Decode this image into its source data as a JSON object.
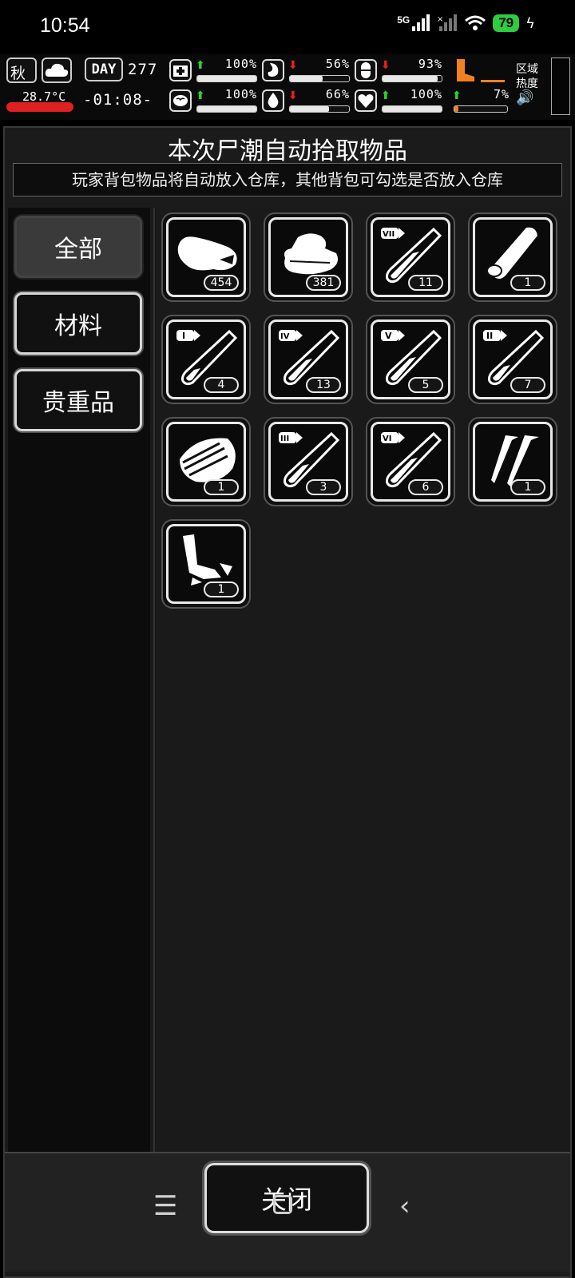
{
  "status_bar": {
    "time": "10:54",
    "network": "5G",
    "battery": "79"
  },
  "hud": {
    "season": "秋",
    "temperature": "28.7°C",
    "day_label": "DAY",
    "day_number": "277",
    "clock": "-01:08-",
    "stats": [
      {
        "icon": "medkit-icon",
        "trend": "up",
        "value": "100%",
        "level": 1.0
      },
      {
        "icon": "stomach-icon",
        "trend": "down",
        "value": "56%",
        "level": 0.56
      },
      {
        "icon": "pill-icon",
        "trend": "down",
        "value": "93%",
        "level": 0.93
      },
      {
        "icon": "brain-icon",
        "trend": "up",
        "value": "100%",
        "level": 1.0
      },
      {
        "icon": "water-drop-icon",
        "trend": "down",
        "value": "66%",
        "level": 0.66
      },
      {
        "icon": "heart-icon",
        "trend": "up",
        "value": "100%",
        "level": 1.0
      }
    ],
    "stamina": {
      "trend": "up",
      "value": "7%",
      "level": 0.07
    },
    "region_heat_label": "区域热度",
    "region_heat_line1": "区域",
    "region_heat_line2": "热度"
  },
  "dialog": {
    "title": "本次尸潮自动拾取物品",
    "subtitle": "玩家背包物品将自动放入仓库，其他背包可勾选是否放入仓库",
    "tabs": [
      {
        "label": "全部",
        "active": true
      },
      {
        "label": "材料",
        "active": false
      },
      {
        "label": "贵重品",
        "active": false
      }
    ],
    "items": [
      {
        "icon": "raw-meat-icon",
        "count": "454"
      },
      {
        "icon": "cloth-icon",
        "count": "381"
      },
      {
        "icon": "test-tube-vii-icon",
        "tier": "VII",
        "count": "11"
      },
      {
        "icon": "wood-log-icon",
        "count": "1"
      },
      {
        "icon": "test-tube-i-icon",
        "tier": "I",
        "count": "4"
      },
      {
        "icon": "test-tube-iv-icon",
        "tier": "IV",
        "count": "13"
      },
      {
        "icon": "test-tube-v-icon",
        "tier": "V",
        "count": "5"
      },
      {
        "icon": "test-tube-ii-icon",
        "tier": "II",
        "count": "7"
      },
      {
        "icon": "scrap-bowl-icon",
        "count": "1"
      },
      {
        "icon": "test-tube-iii-icon",
        "tier": "III",
        "count": "3"
      },
      {
        "icon": "test-tube-vi-icon",
        "tier": "VI",
        "count": "6"
      },
      {
        "icon": "screws-icon",
        "count": "1"
      },
      {
        "icon": "metal-scrap-icon",
        "count": "1"
      }
    ],
    "close_label": "关闭"
  }
}
